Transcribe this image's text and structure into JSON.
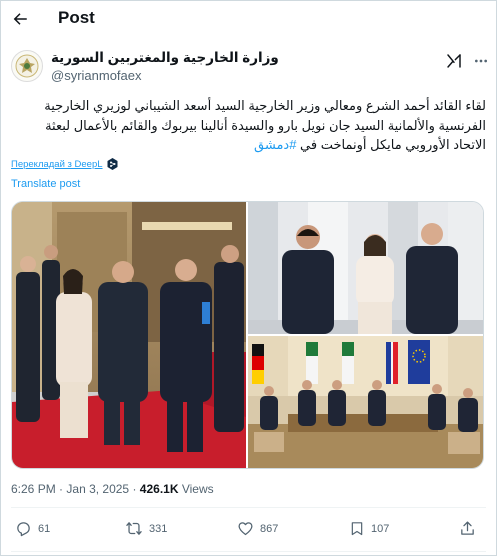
{
  "header": {
    "title": "Post"
  },
  "author": {
    "name": "وزارة الخارجية والمغتربين السورية",
    "handle": "@syrianmofaex"
  },
  "post": {
    "text_main": "لقاء القائد أحمد الشرع ومعالي وزير الخارجية السيد أسعد الشيباني لوزيري الخارجية الفرنسية والألمانية السيد جان نويل بارو والسيدة أنالينا بيربوك والقائم بالأعمال لبعثة الاتحاد الأوروبي مايكل أونماخت في",
    "hashtag": "#دمشق",
    "translate_deepl": "Перекладай з DeepL",
    "translate_post": "Translate post"
  },
  "meta": {
    "time": "6:26 PM",
    "separator": "·",
    "date": "Jan 3, 2025",
    "views_count": "426.1K",
    "views_label": "Views"
  },
  "actions": {
    "replies": "61",
    "reposts": "331",
    "likes": "867",
    "bookmarks": "107"
  },
  "icons": {
    "back": "arrow-left-icon",
    "grok": "grok-icon",
    "more": "more-icon",
    "reply": "reply-icon",
    "repost": "repost-icon",
    "like": "heart-icon",
    "bookmark": "bookmark-icon",
    "share": "share-icon",
    "deepl": "deepl-icon"
  },
  "colors": {
    "accent": "#1d9bf0",
    "text": "#0f1419",
    "muted": "#536471",
    "border": "#cfd9de"
  }
}
